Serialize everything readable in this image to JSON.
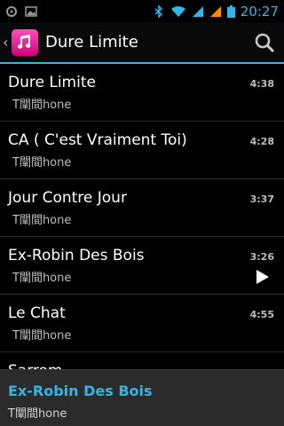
{
  "status": {
    "time": "20:27",
    "left_icons": [
      "usb-debug-icon",
      "image-notification-icon"
    ],
    "right_icons": [
      "bluetooth-icon",
      "wifi-icon",
      "signal-icon",
      "signal-icon-2",
      "battery-icon"
    ]
  },
  "actionbar": {
    "title": "Dure Limite"
  },
  "songs": [
    {
      "title": "Dure Limite",
      "artist": "T闡間hone",
      "duration": "4:38"
    },
    {
      "title": "CA ( C'est Vraiment Toi)",
      "artist": "T闡間hone",
      "duration": "4:28"
    },
    {
      "title": "Jour Contre Jour",
      "artist": "T闡間hone",
      "duration": "3:37"
    },
    {
      "title": "Ex-Robin Des Bois",
      "artist": "T闡間hone",
      "duration": "3:26",
      "playing": true
    },
    {
      "title": "Le Chat",
      "artist": "T闡間hone",
      "duration": "4:55"
    },
    {
      "title": "Sarrom",
      "artist": "",
      "duration": ""
    }
  ],
  "now_playing": {
    "title": "Ex-Robin Des Bois",
    "artist": "T闡間hone"
  },
  "colors": {
    "accent": "#33b5e5",
    "app_icon": "#ff2fa8"
  }
}
